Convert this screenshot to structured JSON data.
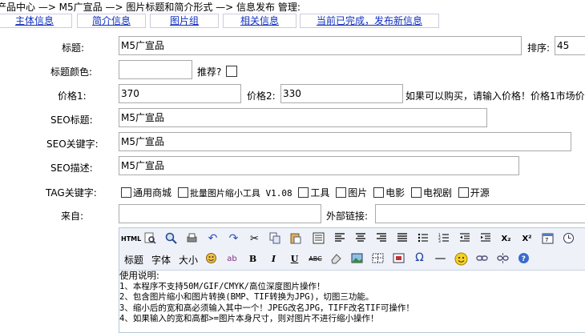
{
  "breadcrumb": "产品中心 —> M5广宣品 —> 图片标题和简介形式 —> 信息发布 管理:",
  "tabs": [
    "主体信息",
    "简介信息",
    "图片组",
    "相关信息",
    "当前已完成，发布新信息"
  ],
  "form": {
    "title_label": "标题:",
    "title_value": "M5广宣品",
    "sort_label": "排序:",
    "sort_value": "45",
    "title_color_label": "标题颜色:",
    "title_color_value": "",
    "recommend_label": "推荐?",
    "price1_label": "价格1:",
    "price1_value": "370",
    "price2_label": "价格2:",
    "price2_value": "330",
    "price_hint": "如果可以购买，请输入价格！价格1市场价",
    "seo_title_label": "SEO标题:",
    "seo_title_value": "M5广宣品",
    "seo_keywords_label": "SEO关键字:",
    "seo_keywords_value": "M5广宣品",
    "seo_desc_label": "SEO描述:",
    "seo_desc_value": "M5广宣品",
    "tag_label": "TAG关键字:",
    "tags": [
      "通用商城",
      "批量图片缩小工具 V1.08",
      "工具",
      "图片",
      "电影",
      "电视剧",
      "开源"
    ],
    "from_label": "来自:",
    "from_value": "",
    "external_link_label": "外部链接:",
    "external_link_value": ""
  },
  "editor": {
    "toolbar_row1": [
      "html-icon",
      "preview-icon",
      "find-icon",
      "print-icon",
      "undo-icon",
      "redo-icon",
      "cut-icon",
      "copy-icon",
      "paste-icon",
      "select-all-icon",
      "align-left-icon",
      "align-center-icon",
      "align-right-icon",
      "justify-icon",
      "unordered-list-icon",
      "ordered-list-icon",
      "outdent-icon",
      "indent-icon",
      "subscript-icon",
      "superscript-icon",
      "date-icon",
      "time-icon"
    ],
    "html_btn": "HTML",
    "sub_btn": "X₂",
    "sup_btn": "X²",
    "format_label": "标题",
    "font_label": "字体",
    "size_label": "大小",
    "bold": "B",
    "italic": "I",
    "underline": "U",
    "strike": "ABC",
    "content_lines": [
      "使用说明:",
      "1、本程序不支持50M/GIF/CMYK/高位深度图片操作！",
      "2、包含图片缩小和图片转换(BMP、TIF转换为JPG)，切图三功能。",
      "3、缩小后的宽和高必须输入其中一个！JPEG改名JPG，TIFF改名TIF可操作！",
      "4、如果输入的宽和高都>=图片本身尺寸，则对图片不进行缩小操作！"
    ]
  },
  "colors": {
    "tab_text": "#1030c0",
    "border": "#aaaaaa",
    "toolbar_bg": "#eef2f8"
  }
}
